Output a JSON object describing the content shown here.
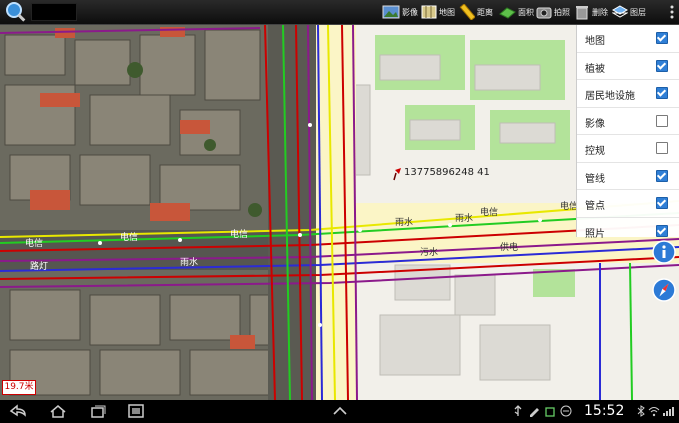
{
  "toolbar": {
    "title": "",
    "buttons": [
      {
        "label": "影像",
        "icon": "image-layer-icon"
      },
      {
        "label": "地图",
        "icon": "map-icon"
      },
      {
        "label": "距离",
        "icon": "ruler-icon"
      },
      {
        "label": "面积",
        "icon": "area-icon"
      },
      {
        "label": "拍照",
        "icon": "camera-icon"
      },
      {
        "label": "删除",
        "icon": "delete-icon"
      },
      {
        "label": "图层",
        "icon": "layers-icon"
      }
    ]
  },
  "map": {
    "phone_label": "13775896248 41",
    "scale": "19.7米",
    "street_labels": [
      "电信",
      "电信",
      "电信",
      "电信",
      "电信",
      "电信",
      "电信",
      "雨水",
      "雨水",
      "雨水",
      "雨水",
      "雨水",
      "污水",
      "污水",
      "供电",
      "供电",
      "路灯",
      "路灯",
      "电信",
      "电信"
    ]
  },
  "layer_panel": {
    "items": [
      {
        "label": "地图",
        "checked": true
      },
      {
        "label": "植被",
        "checked": true
      },
      {
        "label": "居民地设施",
        "checked": true
      },
      {
        "label": "影像",
        "checked": false
      },
      {
        "label": "控规",
        "checked": false
      },
      {
        "label": "管线",
        "checked": true
      },
      {
        "label": "管点",
        "checked": true
      },
      {
        "label": "照片",
        "checked": true
      }
    ]
  },
  "statusbar": {
    "time": "15:52"
  },
  "colors": {
    "water": "#2b2bd6",
    "rain": "#e8e800",
    "power": "#cc0000",
    "telecom": "#22cc22",
    "sewer": "#8b1a8b",
    "vegetation": "#b3e39a"
  }
}
